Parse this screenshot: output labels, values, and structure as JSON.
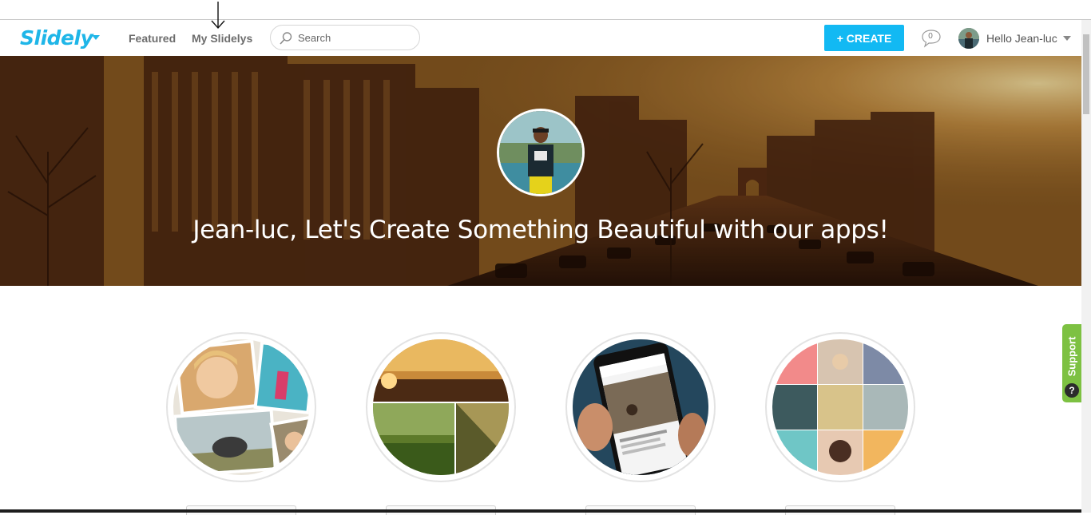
{
  "nav": {
    "logo": "Slidely",
    "featured": "Featured",
    "my_slidelys": "My Slidelys",
    "search_placeholder": "Search",
    "create_label": "+ CREATE",
    "notification_count": "0",
    "greeting": "Hello Jean-luc"
  },
  "hero": {
    "title": "Jean-luc, Let's Create Something Beautiful with our apps!"
  },
  "apps": [
    {
      "name": "photo-collage-app"
    },
    {
      "name": "landscape-photos-app"
    },
    {
      "name": "mobile-app"
    },
    {
      "name": "grid-collage-app"
    }
  ],
  "support": {
    "label": "Support",
    "help_glyph": "?"
  },
  "colors": {
    "brand": "#1fb6e8",
    "create_button": "#12b9f3",
    "support_tab": "#7dc142"
  },
  "icons": {
    "search": "search-icon",
    "notifications": "chat-bubble-icon",
    "logo_menu": "chevron-down-icon",
    "user_menu": "chevron-down-icon"
  }
}
